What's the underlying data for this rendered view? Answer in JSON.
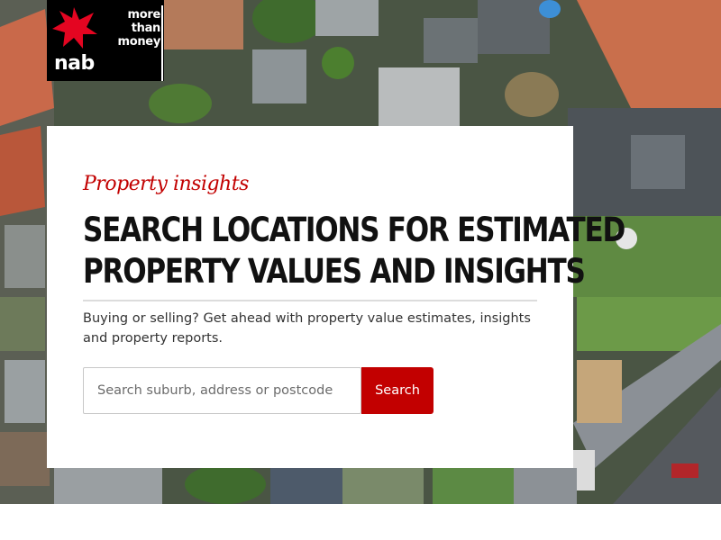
{
  "brand": {
    "logo_text": "nab",
    "tagline_lines": [
      "more",
      "than",
      "money"
    ],
    "logo_icon": "star-icon",
    "accent_color": "#c20000"
  },
  "hero": {
    "background": "aerial-neighbourhood-photo"
  },
  "card": {
    "eyebrow": "Property insights",
    "headline_line1": "SEARCH LOCATIONS FOR ESTIMATED",
    "headline_line2": "PROPERTY VALUES AND INSIGHTS",
    "description": "Buying or selling? Get ahead with property value estimates, insights and property reports."
  },
  "search": {
    "placeholder": "Search suburb, address or postcode",
    "button_label": "Search"
  }
}
